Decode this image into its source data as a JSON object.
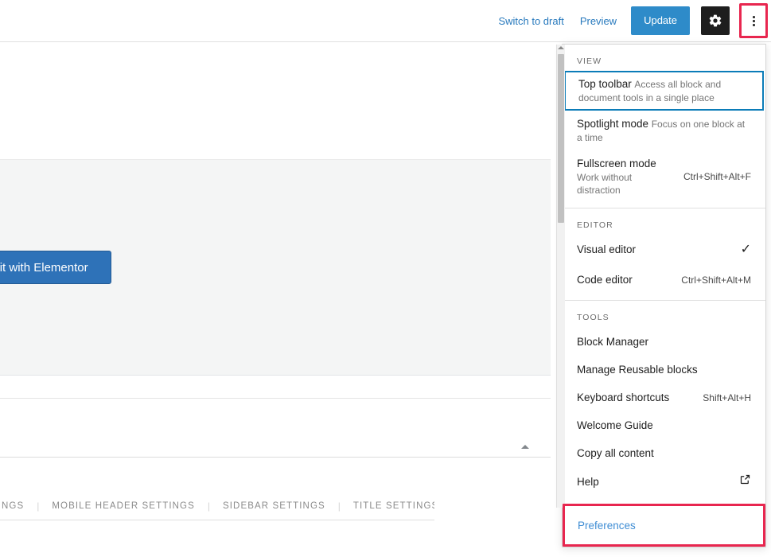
{
  "topbar": {
    "switch_to_draft": "Switch to draft",
    "preview": "Preview",
    "update": "Update",
    "settings_icon": "gear-icon",
    "more_options_icon": "kebab-menu-icon"
  },
  "canvas": {
    "elementor_button": "Edit with Elementor",
    "collapse_icon": "caret-up-icon",
    "settings_tabs": [
      "NGS",
      "MOBILE HEADER SETTINGS",
      "SIDEBAR SETTINGS",
      "TITLE SETTINGS"
    ]
  },
  "more_menu": {
    "sections": [
      {
        "label": "VIEW",
        "items": [
          {
            "title": "Top toolbar",
            "description": "Access all block and document tools in a single place",
            "shortcut": "",
            "checked": false,
            "focused": true
          },
          {
            "title": "Spotlight mode",
            "description": "Focus on one block at a time",
            "shortcut": "",
            "checked": false,
            "focused": false
          },
          {
            "title": "Fullscreen mode",
            "description": "Work without distraction",
            "shortcut": "Ctrl+Shift+Alt+F",
            "checked": false,
            "focused": false
          }
        ]
      },
      {
        "label": "EDITOR",
        "items": [
          {
            "title": "Visual editor",
            "description": "",
            "shortcut": "",
            "checked": true,
            "focused": false
          },
          {
            "title": "Code editor",
            "description": "",
            "shortcut": "Ctrl+Shift+Alt+M",
            "checked": false,
            "focused": false
          }
        ]
      },
      {
        "label": "TOOLS",
        "items": [
          {
            "title": "Block Manager",
            "description": "",
            "shortcut": "",
            "checked": false,
            "focused": false
          },
          {
            "title": "Manage Reusable blocks",
            "description": "",
            "shortcut": "",
            "checked": false,
            "focused": false
          },
          {
            "title": "Keyboard shortcuts",
            "description": "",
            "shortcut": "Shift+Alt+H",
            "checked": false,
            "focused": false
          },
          {
            "title": "Welcome Guide",
            "description": "",
            "shortcut": "",
            "checked": false,
            "focused": false
          },
          {
            "title": "Copy all content",
            "description": "",
            "shortcut": "",
            "checked": false,
            "focused": false
          },
          {
            "title": "Help",
            "description": "",
            "shortcut": "",
            "checked": false,
            "focused": false,
            "external_icon": "external-link-icon"
          }
        ]
      }
    ],
    "preferences": "Preferences"
  },
  "colors": {
    "accent_blue": "#2e8bc9",
    "link_blue": "#2779bd",
    "focus_blue": "#0b7cb8",
    "highlight_red": "#e8264f",
    "elementor_blue": "#2e72b8",
    "dark_button": "#1e1e1e"
  }
}
